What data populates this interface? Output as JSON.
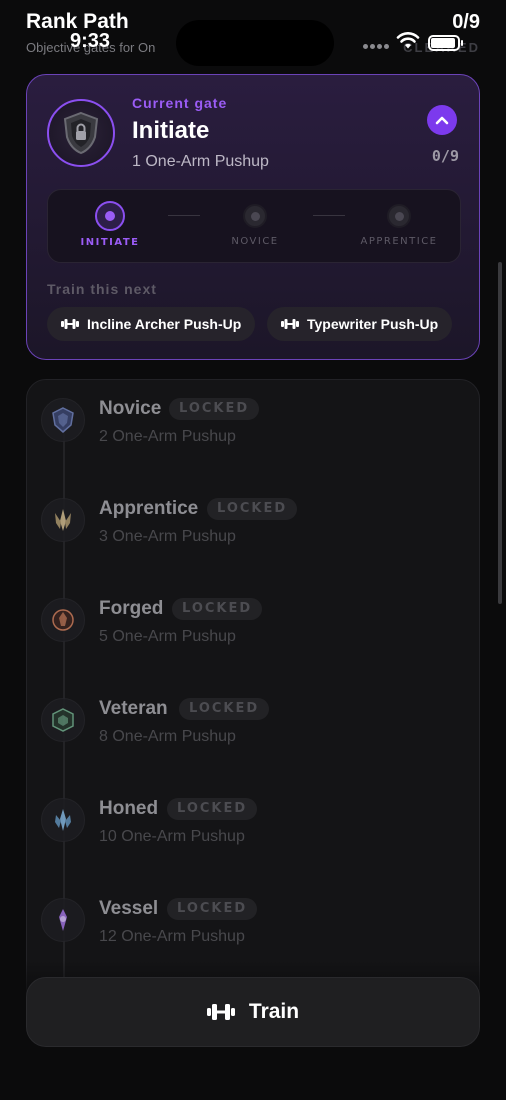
{
  "header": {
    "title": "Rank Path",
    "subtitle": "Objective gates for On",
    "count": "0/9",
    "cleared_label": "CLEARED",
    "clock": "9:33"
  },
  "current_gate": {
    "label": "Current gate",
    "name": "Initiate",
    "requirement": "1 One-Arm Pushup",
    "progress": "0/9",
    "accent": "#9b5cf6",
    "steps": [
      {
        "label": "INITIATE",
        "active": true
      },
      {
        "label": "NOVICE",
        "active": false
      },
      {
        "label": "APPRENTICE",
        "active": false
      }
    ],
    "next_label": "Train this next",
    "suggestions": [
      "Incline Archer Push-Up",
      "Typewriter Push-Up"
    ]
  },
  "ranks": [
    {
      "name": "Novice",
      "badge": "LOCKED",
      "requirement": "2 One-Arm Pushup",
      "icon": "novice-icon",
      "color": "#6f7fb8"
    },
    {
      "name": "Apprentice",
      "badge": "LOCKED",
      "requirement": "3 One-Arm Pushup",
      "icon": "apprentice-icon",
      "color": "#c9b48a"
    },
    {
      "name": "Forged",
      "badge": "LOCKED",
      "requirement": "5 One-Arm Pushup",
      "icon": "forged-icon",
      "color": "#c77a5a"
    },
    {
      "name": "Veteran",
      "badge": "LOCKED",
      "requirement": "8 One-Arm Pushup",
      "icon": "veteran-icon",
      "color": "#6fa88a"
    },
    {
      "name": "Honed",
      "badge": "LOCKED",
      "requirement": "10 One-Arm Pushup",
      "icon": "honed-icon",
      "color": "#7fb0d8"
    },
    {
      "name": "Vessel",
      "badge": "LOCKED",
      "requirement": "12 One-Arm Pushup",
      "icon": "vessel-icon",
      "color": "#9b6fd8"
    }
  ],
  "train_button": {
    "label": "Train",
    "icon": "dumbbell-icon"
  }
}
